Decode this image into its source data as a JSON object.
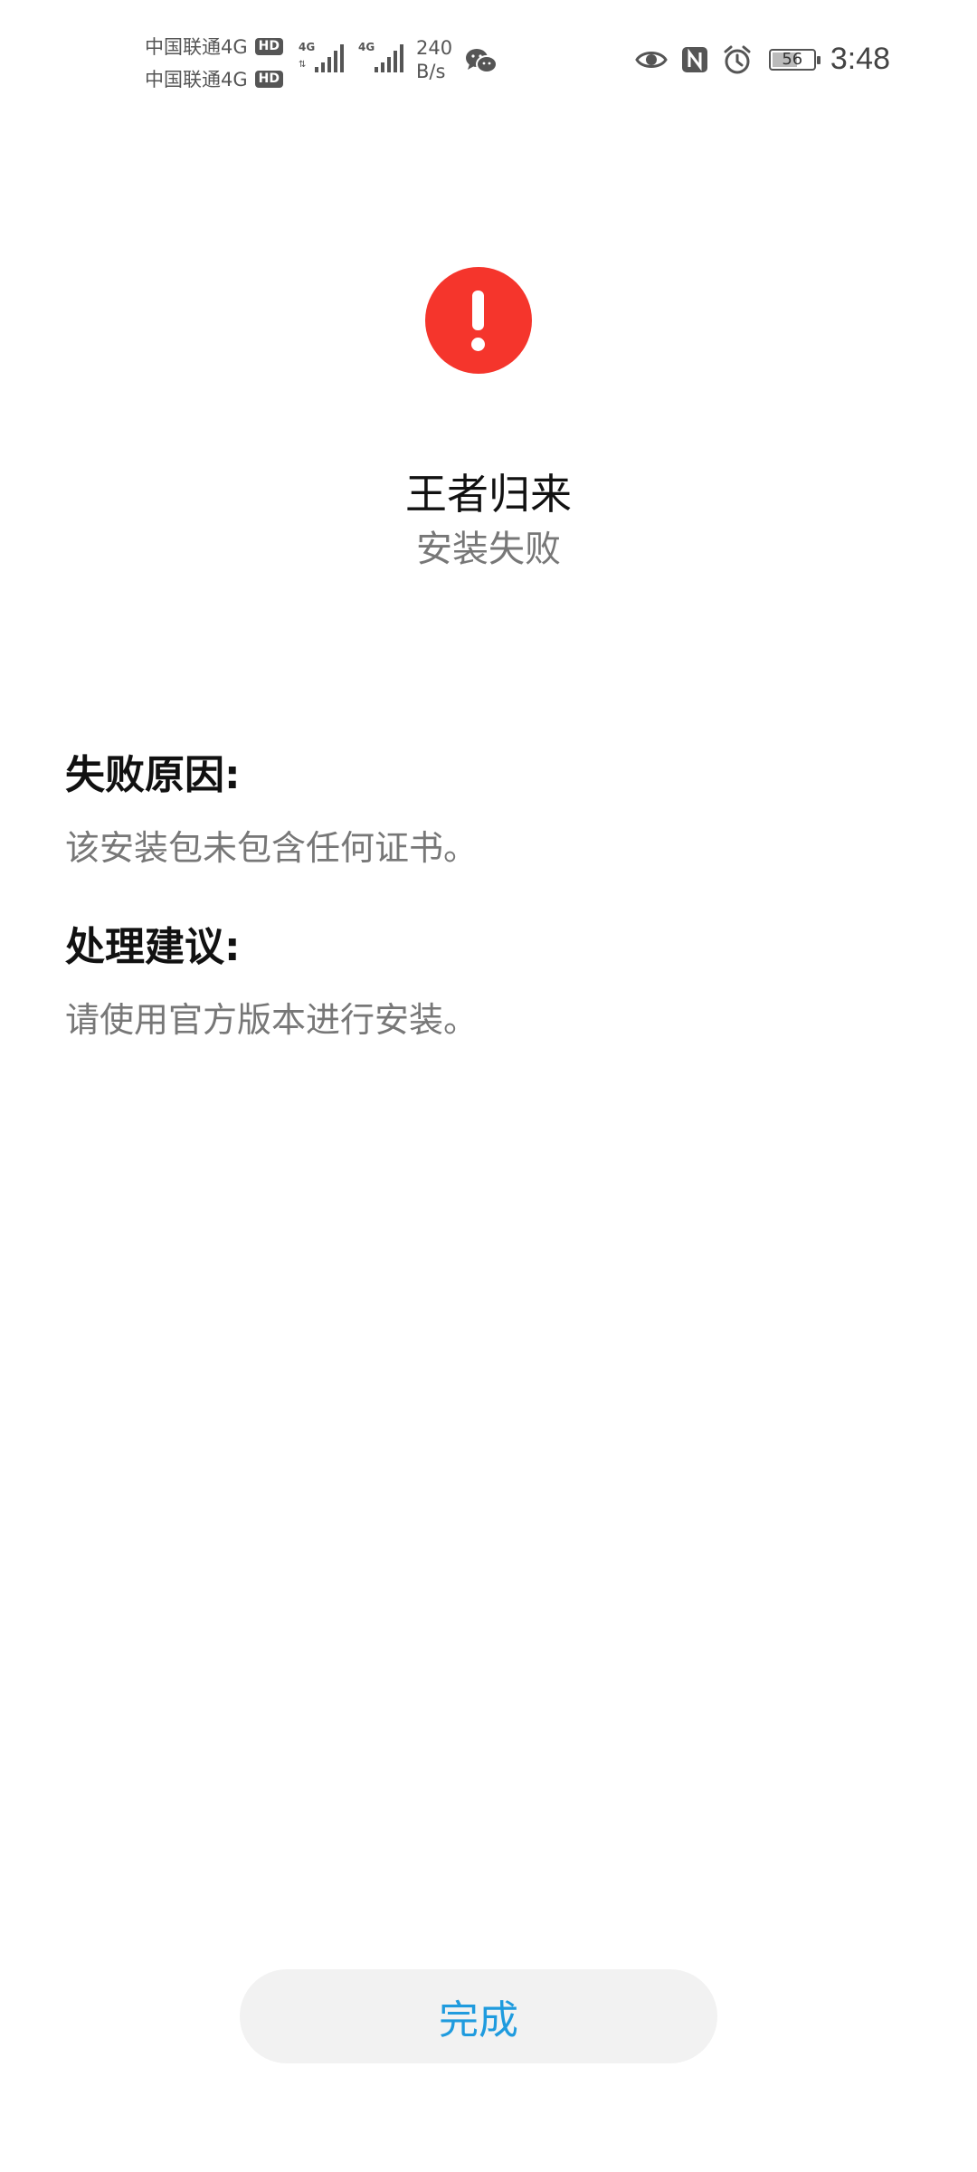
{
  "status_bar": {
    "carrier_1": "中国联通4G",
    "carrier_2": "中国联通4G",
    "hd_badge": "HD",
    "net_speed_value": "240",
    "net_speed_unit": "B/s",
    "battery_level": "56",
    "time": "3:48",
    "icons": [
      "signal-4g-icon",
      "signal-4g-icon",
      "wechat-icon",
      "eye-icon",
      "nfc-icon",
      "alarm-icon",
      "battery-icon"
    ]
  },
  "main": {
    "app_name": "王者归来",
    "status": "安装失败",
    "failure_reason_title": "失败原因:",
    "failure_reason_text": "该安装包未包含任何证书。",
    "suggestion_title": "处理建议:",
    "suggestion_text": "请使用官方版本进行安装。"
  },
  "actions": {
    "done_label": "完成"
  },
  "colors": {
    "error": "#f5352c",
    "accent": "#1f9bde",
    "button_bg": "#f2f2f2"
  }
}
